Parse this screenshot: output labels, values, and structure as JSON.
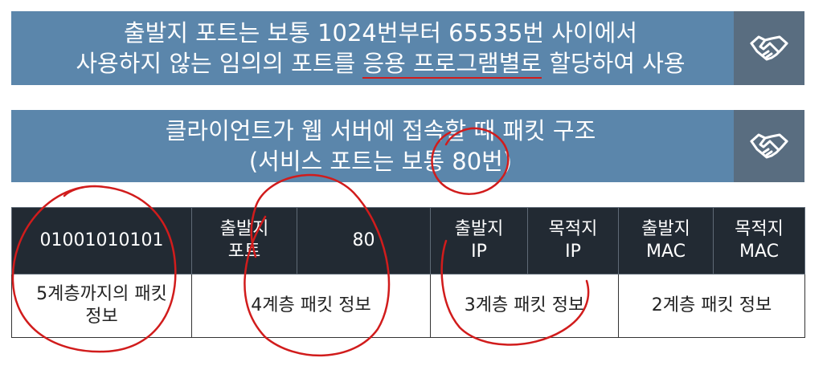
{
  "banner_top": {
    "line1": "출발지 포트는 보통 1024번부터 65535번 사이에서",
    "line2_before": "사용하지 않는 임의의 포트를 ",
    "line2_underlined": "응용 프로그램별로",
    "line2_after": " 할당하여 사용",
    "icon": "handshake-icon"
  },
  "banner_middle": {
    "line1": "클라이언트가 웹 서버에 접속할 때 패킷 구조",
    "line2": "(서비스 포트는 보통 80번)",
    "icon": "handshake-icon"
  },
  "packet_table": {
    "header": {
      "data": "01001010101",
      "src_port_label_1": "출발지",
      "src_port_label_2": "포트",
      "port_value": "80",
      "src_ip_1": "출발지",
      "src_ip_2": "IP",
      "dst_ip_1": "목적지",
      "dst_ip_2": "IP",
      "src_mac_1": "출발지",
      "src_mac_2": "MAC",
      "dst_mac_1": "목적지",
      "dst_mac_2": "MAC"
    },
    "layers": {
      "layer5_1": "5계층까지의 패킷",
      "layer5_2": "정보",
      "layer4": "4계층 패킷 정보",
      "layer3": "3계층 패킷 정보",
      "layer2": "2계층 패킷 정보"
    }
  },
  "colors": {
    "banner_bg": "#5b86ab",
    "icon_bg": "#596d80",
    "header_bg": "#222a33",
    "annotation": "#d11c1c"
  }
}
